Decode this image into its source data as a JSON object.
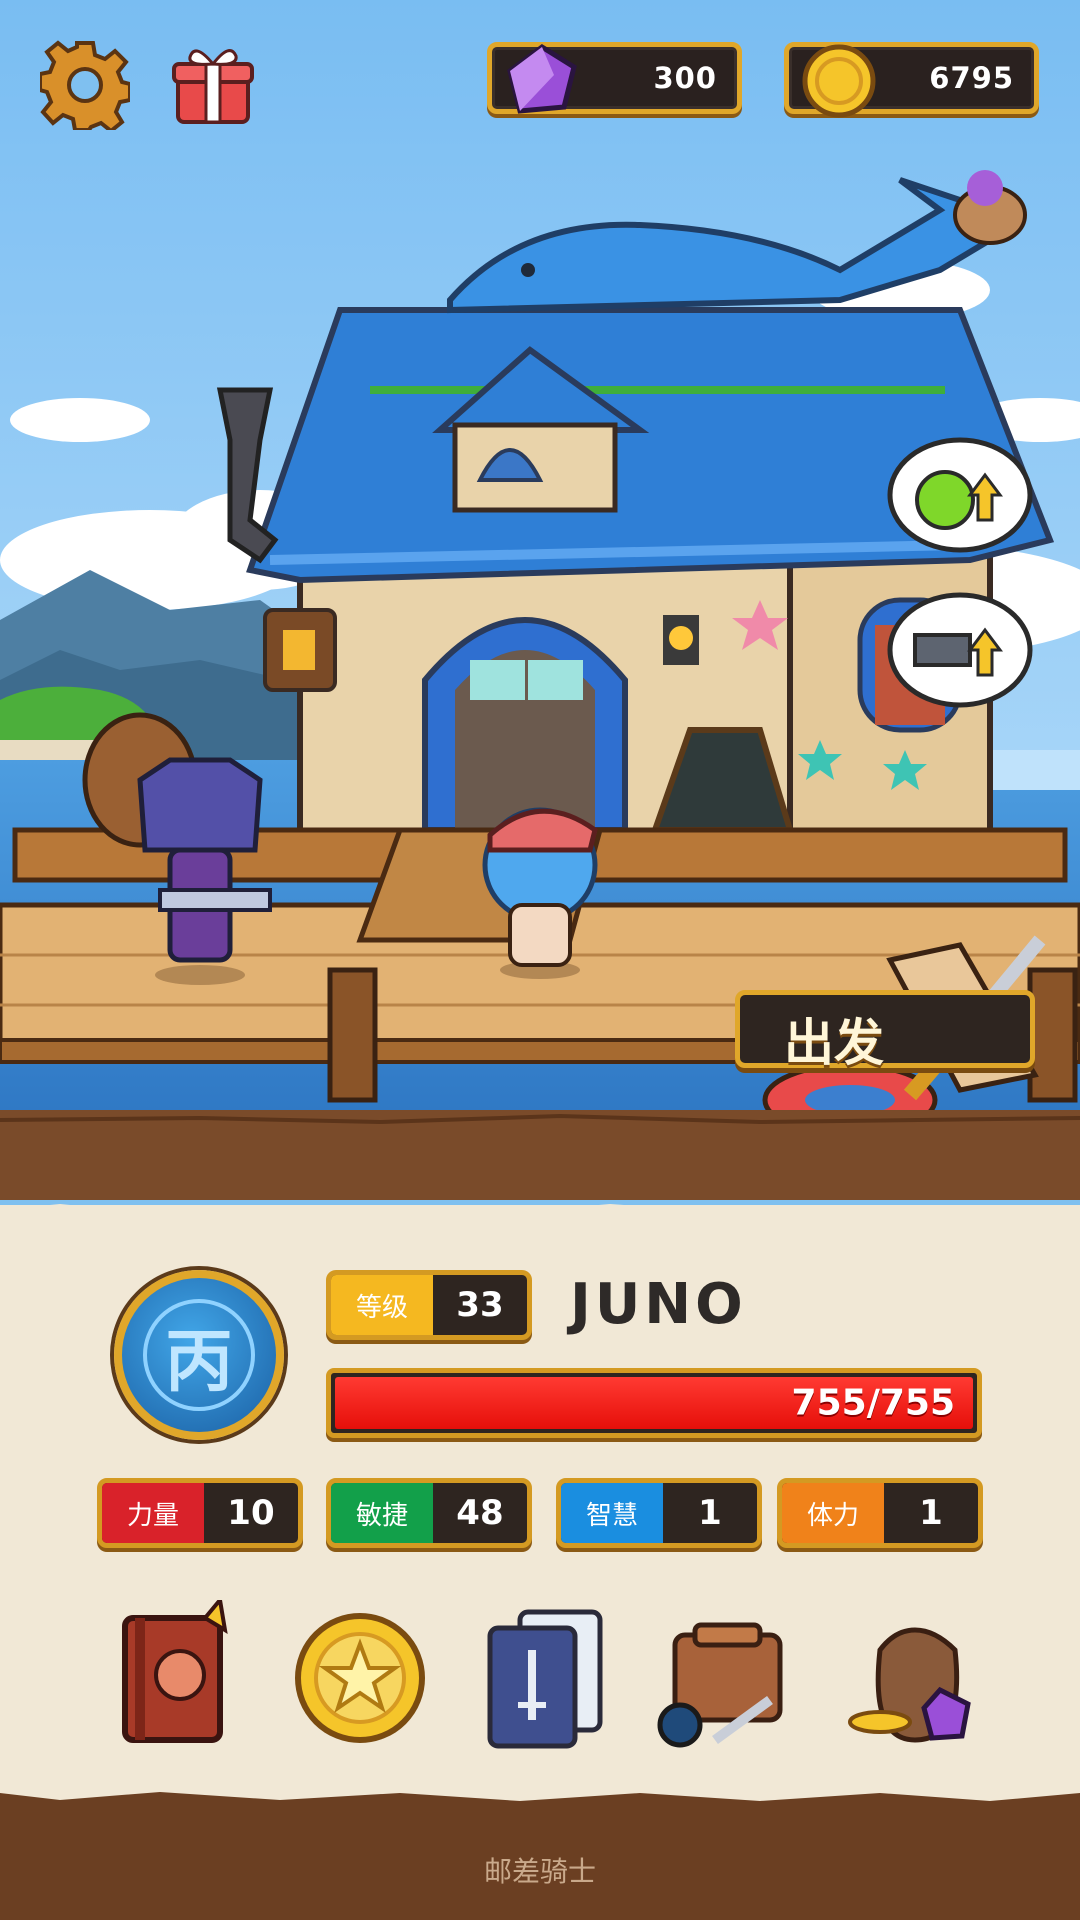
{
  "currency": {
    "gems": "300",
    "coins": "6795"
  },
  "actions": {
    "depart_label": "出发"
  },
  "hero": {
    "name": "JUNO",
    "rank_glyph": "丙",
    "level_label": "等级",
    "level": "33",
    "hp_text": "755/755",
    "hp_fraction": 1.0
  },
  "stats": [
    {
      "label": "力量",
      "value": "10",
      "color": "#d9222a"
    },
    {
      "label": "敏捷",
      "value": "48",
      "color": "#12a04a"
    },
    {
      "label": "智慧",
      "value": "1",
      "color": "#1a8ee0"
    },
    {
      "label": "体力",
      "value": "1",
      "color": "#f0821a"
    }
  ],
  "menu": [
    {
      "icon": "hero-book-icon"
    },
    {
      "icon": "star-coin-icon"
    },
    {
      "icon": "sword-cards-icon"
    },
    {
      "icon": "inventory-bag-icon"
    },
    {
      "icon": "treasure-sack-icon"
    }
  ],
  "footer": {
    "title": "邮差骑士"
  },
  "colors": {
    "level_badge": "#f5b820",
    "frame_gold": "#e0a72a",
    "hp_red": "#ee1a12"
  }
}
